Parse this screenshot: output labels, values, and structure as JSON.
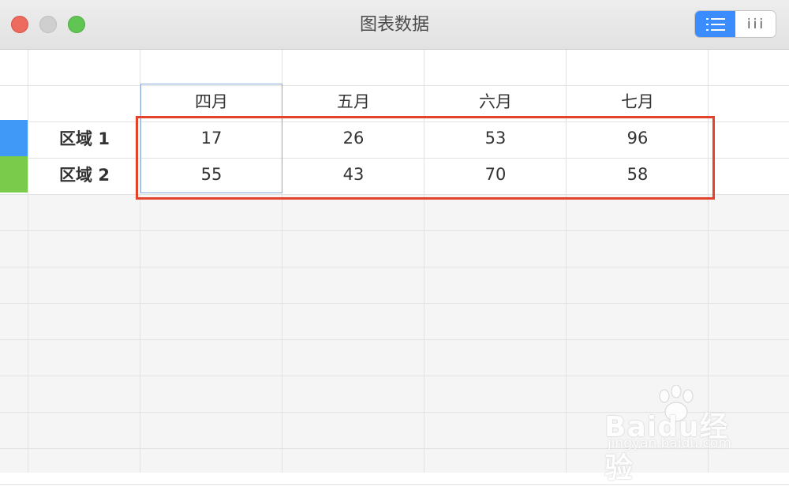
{
  "window": {
    "title": "图表数据"
  },
  "toolbar": {
    "list_view_icon": "list-icon",
    "column_view_label": "iii"
  },
  "table": {
    "column_headers": [
      "四月",
      "五月",
      "六月",
      "七月"
    ],
    "rows": [
      {
        "label": "区域 1",
        "color": "#4098f7",
        "values": [
          "17",
          "26",
          "53",
          "96"
        ]
      },
      {
        "label": "区域 2",
        "color": "#7acb4c",
        "values": [
          "55",
          "43",
          "70",
          "58"
        ]
      }
    ]
  },
  "watermark": {
    "brand": "Baidu经验",
    "url": "jingyan.baidu.com"
  }
}
